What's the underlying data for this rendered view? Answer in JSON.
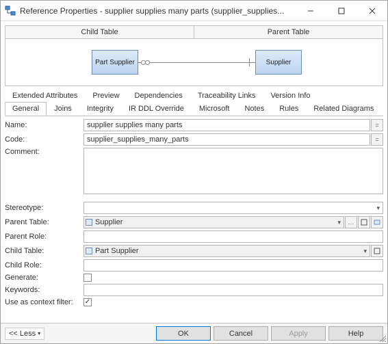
{
  "title": "Reference Properties - supplier supplies many parts (supplier_supplies...",
  "diagram": {
    "child_header": "Child Table",
    "parent_header": "Parent Table",
    "child_entity": "Part Supplier",
    "parent_entity": "Supplier"
  },
  "tabs_row1": [
    "Extended Attributes",
    "Preview",
    "Dependencies",
    "Traceability Links",
    "Version Info"
  ],
  "tabs_row2": [
    "General",
    "Joins",
    "Integrity",
    "IR DDL Override",
    "Microsoft",
    "Notes",
    "Rules",
    "Related Diagrams"
  ],
  "active_tab": "General",
  "form": {
    "name_label": "Name:",
    "name_value": "supplier supplies many parts",
    "code_label": "Code:",
    "code_value": "supplier_supplies_many_parts",
    "comment_label": "Comment:",
    "comment_value": "",
    "stereotype_label": "Stereotype:",
    "stereotype_value": "",
    "parent_table_label": "Parent Table:",
    "parent_table_value": "Supplier",
    "parent_role_label": "Parent Role:",
    "parent_role_value": "",
    "child_table_label": "Child Table:",
    "child_table_value": "Part Supplier",
    "child_role_label": "Child Role:",
    "child_role_value": "",
    "generate_label": "Generate:",
    "generate_checked": false,
    "keywords_label": "Keywords:",
    "keywords_value": "",
    "context_label": "Use as context filter:",
    "context_checked": true,
    "lock_glyph": "="
  },
  "buttons": {
    "less": "<< Less",
    "ok": "OK",
    "cancel": "Cancel",
    "apply": "Apply",
    "help": "Help"
  },
  "icons": {
    "chevron": "▾",
    "check": "✓"
  }
}
